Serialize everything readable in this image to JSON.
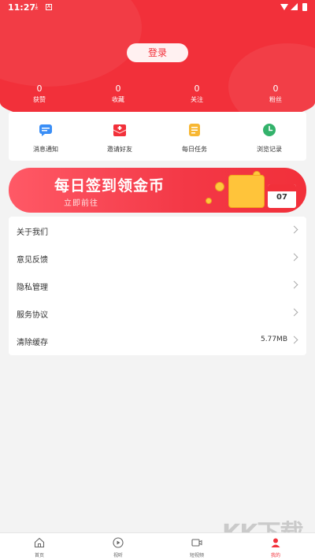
{
  "status_bar": {
    "time": "11:27"
  },
  "header": {
    "login_label": "登录"
  },
  "stats": [
    {
      "value": "0",
      "label": "获赞"
    },
    {
      "value": "0",
      "label": "收藏"
    },
    {
      "value": "0",
      "label": "关注"
    },
    {
      "value": "0",
      "label": "粉丝"
    }
  ],
  "quick_actions": [
    {
      "label": "消息通知",
      "icon": "message-icon",
      "color": "#3a8ef6"
    },
    {
      "label": "邀请好友",
      "icon": "envelope-icon",
      "color": "#f2303a"
    },
    {
      "label": "每日任务",
      "icon": "task-icon",
      "color": "#f7b733"
    },
    {
      "label": "浏览记录",
      "icon": "clock-icon",
      "color": "#33b26b"
    }
  ],
  "banner": {
    "title": "每日签到领金币",
    "subtitle": "立即前往",
    "calendar_day": "07"
  },
  "menu": [
    {
      "label": "关于我们",
      "value": ""
    },
    {
      "label": "意见反馈",
      "value": ""
    },
    {
      "label": "隐私管理",
      "value": ""
    },
    {
      "label": "服务协议",
      "value": ""
    },
    {
      "label": "清除缓存",
      "value": "5.77MB"
    }
  ],
  "bottom_nav": [
    {
      "label": "首页",
      "icon": "home-icon",
      "active": false
    },
    {
      "label": "视听",
      "icon": "play-icon",
      "active": false
    },
    {
      "label": "短视频",
      "icon": "video-icon",
      "active": false
    },
    {
      "label": "我的",
      "icon": "profile-icon",
      "active": true
    }
  ],
  "watermark": {
    "text": "KK下载",
    "url": "www.kkx.net"
  },
  "colors": {
    "accent": "#f2303a",
    "background": "#f3f3f3"
  }
}
